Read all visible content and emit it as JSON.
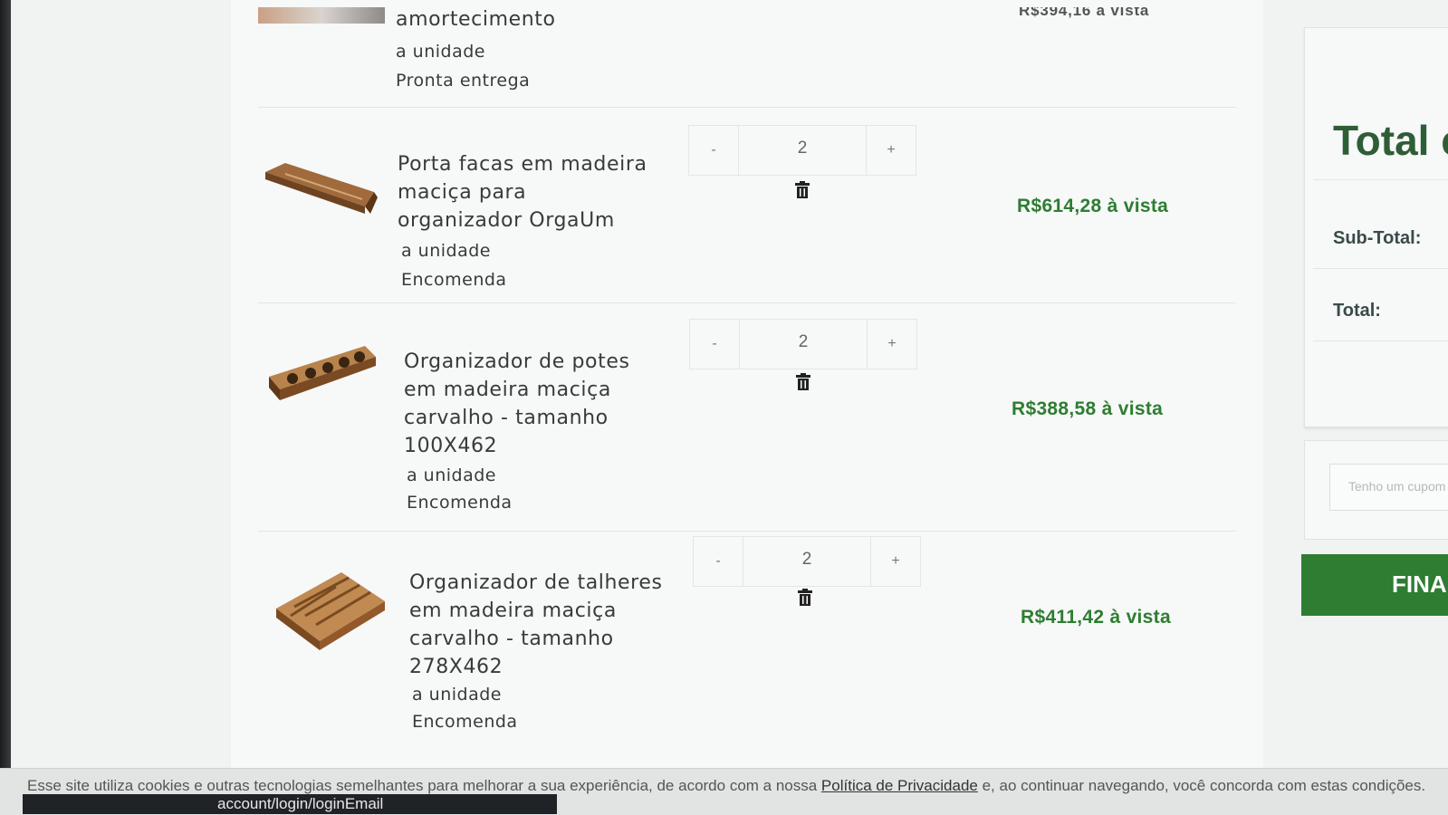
{
  "prev_item": {
    "name_tail": "amortecimento",
    "unit": "a unidade",
    "availability": "Pronta entrega",
    "price_partial": "R$394,16 à vista"
  },
  "items": [
    {
      "name_lines": [
        "Porta facas em madeira",
        "maciça para",
        "organizador OrgaUm"
      ],
      "unit": "a unidade",
      "availability": "Encomenda",
      "quantity": "2",
      "minus": "-",
      "plus": "+",
      "price": "R$614,28 à vista"
    },
    {
      "name_lines": [
        "Organizador de potes",
        "em madeira maciça",
        "carvalho - tamanho",
        "100X462"
      ],
      "unit": "a unidade",
      "availability": "Encomenda",
      "quantity": "2",
      "minus": "-",
      "plus": "+",
      "price": "R$388,58 à vista"
    },
    {
      "name_lines": [
        "Organizador de talheres",
        "em madeira maciça",
        "carvalho - tamanho",
        "278X462"
      ],
      "unit": "a unidade",
      "availability": "Encomenda",
      "quantity": "2",
      "minus": "-",
      "plus": "+",
      "price": "R$411,42 à vista"
    }
  ],
  "summary": {
    "title": "Total c",
    "subtotal_label": "Sub-Total:",
    "total_label": "Total:",
    "coupon_placeholder": "Tenho um cupom",
    "finalize_label": "FINA"
  },
  "cookie": {
    "prefix": "Esse site utiliza cookies e outras tecnologias semelhantes para melhorar a sua experiência, de acordo com a nossa ",
    "link": "Política de Privacidade",
    "suffix": " e, ao continuar navegando, você concorda com estas condições."
  },
  "status_url": "account/login/loginEmail",
  "colors": {
    "price_green": "#2e7d32",
    "button_green": "#2e7d32",
    "title_green": "#2f5d36"
  }
}
